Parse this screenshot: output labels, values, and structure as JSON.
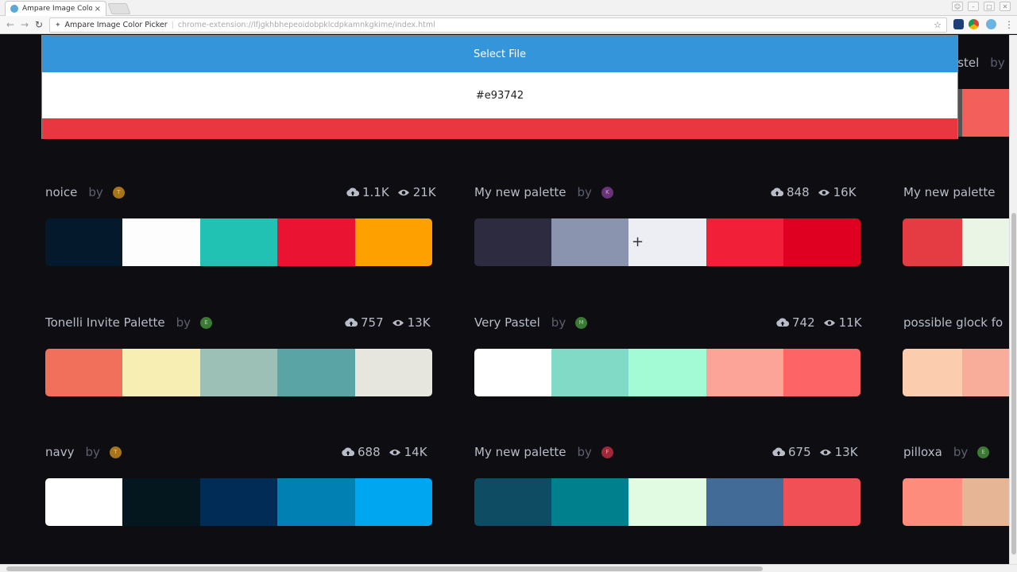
{
  "browser": {
    "tab_title": "Ampare Image Color Pi",
    "tab_close": "×",
    "omnibox_name": "Ampare Image Color Picker",
    "omnibox_url": "chrome-extension://lfjgkhbhepeoidobpklcdpkamnkgkime/index.html"
  },
  "overlay": {
    "select_file_label": "Select File",
    "hex_value": "#e93742",
    "picked_color": "#e93742"
  },
  "partial_header": "astel",
  "partial_by": "by",
  "palettes": [
    {
      "name": "noice",
      "by": "by",
      "avatar_letter": "T",
      "avatar_color": "#a8741a",
      "likes": "1.1K",
      "views": "21K",
      "colors": [
        "#04192b",
        "#fdfdfd",
        "#21c2b4",
        "#ea1432",
        "#fea000"
      ]
    },
    {
      "name": "My new palette",
      "by": "by",
      "avatar_letter": "K",
      "avatar_color": "#6a3278",
      "likes": "848",
      "views": "16K",
      "colors": [
        "#2c2b40",
        "#8b94ae",
        "#edeef3",
        "#f21f38",
        "#df0021"
      ]
    },
    {
      "name": "My new palette",
      "by": "",
      "avatar_letter": "",
      "avatar_color": "",
      "likes": "",
      "views": "",
      "colors": [
        "#e53b43",
        "#eaf5e6"
      ]
    },
    {
      "name": "Tonelli Invite Palette",
      "by": "by",
      "avatar_letter": "E",
      "avatar_color": "#3a7a33",
      "likes": "757",
      "views": "13K",
      "colors": [
        "#f0705c",
        "#f6eeb3",
        "#9dc0b6",
        "#5ba4a6",
        "#e6e6de"
      ]
    },
    {
      "name": "Very Pastel",
      "by": "by",
      "avatar_letter": "M",
      "avatar_color": "#3a7a33",
      "likes": "742",
      "views": "11K",
      "colors": [
        "#ffffff",
        "#80dac6",
        "#a2fbd4",
        "#fba497",
        "#fd6466"
      ]
    },
    {
      "name": "possible glock fo",
      "by": "",
      "avatar_letter": "",
      "avatar_color": "",
      "likes": "",
      "views": "",
      "colors": [
        "#fcccaf",
        "#f8ad9b"
      ]
    },
    {
      "name": "navy",
      "by": "by",
      "avatar_letter": "T",
      "avatar_color": "#a8741a",
      "likes": "688",
      "views": "14K",
      "colors": [
        "#ffffff",
        "#04171f",
        "#002c55",
        "#0080b3",
        "#00a6ef"
      ]
    },
    {
      "name": "My new palette",
      "by": "by",
      "avatar_letter": "F",
      "avatar_color": "#a02838",
      "likes": "675",
      "views": "13K",
      "colors": [
        "#0d4c63",
        "#007f8c",
        "#e1fbe3",
        "#426b98",
        "#f15056"
      ]
    },
    {
      "name": "pilloxa",
      "by": "by",
      "avatar_letter": "E",
      "avatar_color": "#3a7a33",
      "likes": "",
      "views": "",
      "colors": [
        "#fe8c7c",
        "#e5b596"
      ]
    }
  ],
  "top_partial_colors": [
    "#545553",
    "#f35f5a"
  ]
}
